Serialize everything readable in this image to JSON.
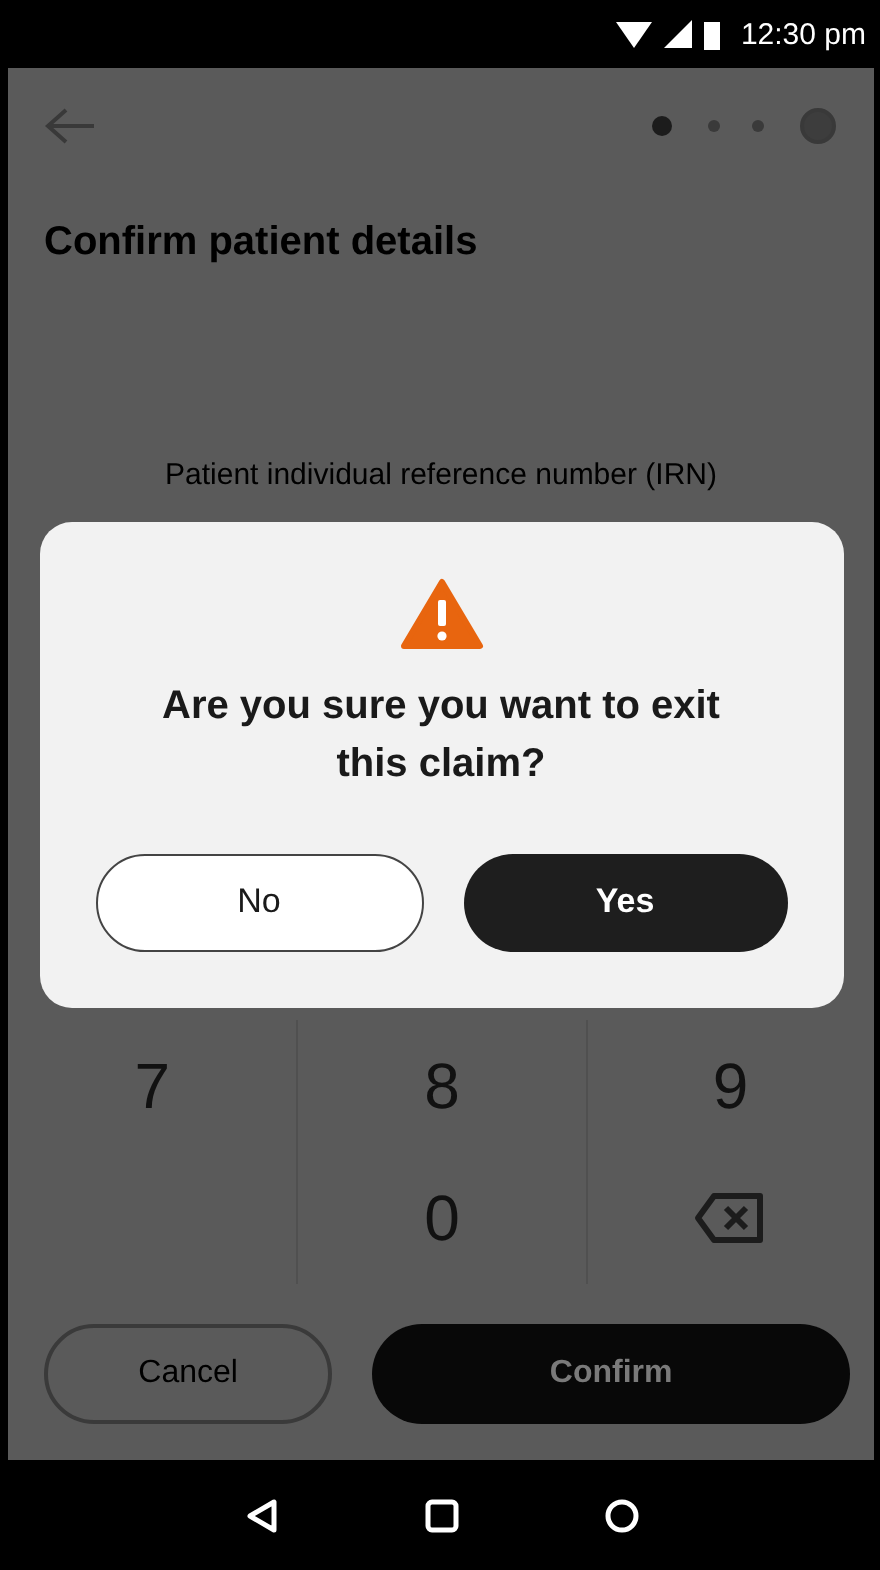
{
  "status_bar": {
    "time": "12:30 pm"
  },
  "title": "Confirm patient details",
  "field": {
    "label": "Patient individual reference number (IRN)"
  },
  "keypad": [
    {
      "kind": "digit",
      "label": "7"
    },
    {
      "kind": "digit",
      "label": "8"
    },
    {
      "kind": "digit",
      "label": "9"
    },
    {
      "kind": "blank"
    },
    {
      "kind": "digit",
      "label": "0"
    },
    {
      "kind": "backspace"
    }
  ],
  "actions": [
    {
      "kind": "secondary",
      "label": "Cancel"
    },
    {
      "kind": "primary",
      "label": "Confirm"
    }
  ],
  "dialog": {
    "message": "Are you sure you want to exit this claim?",
    "buttons": [
      {
        "kind": "secondary",
        "label": "No"
      },
      {
        "kind": "primary",
        "label": "Yes"
      }
    ]
  }
}
